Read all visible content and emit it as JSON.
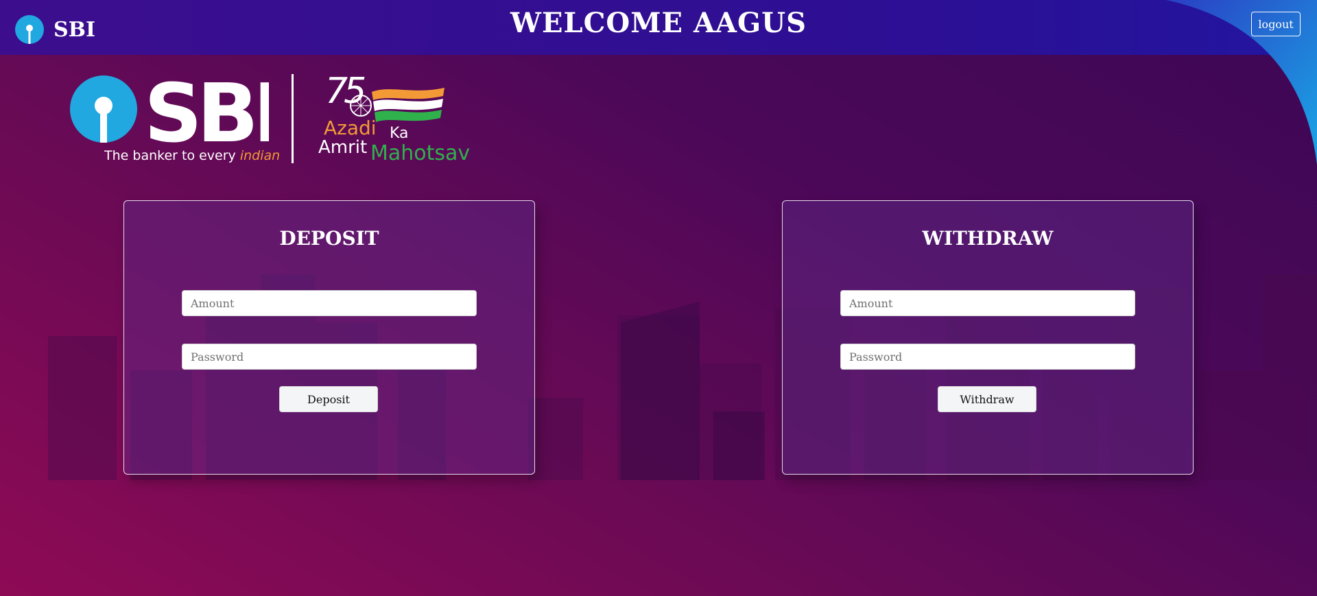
{
  "header": {
    "brand_name": "SBI",
    "welcome_text": "WELCOME AAGUS",
    "logout_label": "logout"
  },
  "logo_banner": {
    "tagline_prefix": "The banker to every",
    "tagline_highlight": "indian",
    "emblem_number": "75",
    "azadi": "Azadi",
    "ka": "Ka",
    "amrit": "Amrit",
    "mahotsav": "Mahotsav"
  },
  "deposit": {
    "title": "DEPOSIT",
    "amount_placeholder": "Amount",
    "password_placeholder": "Password",
    "button_label": "Deposit"
  },
  "withdraw": {
    "title": "WITHDRAW",
    "amount_placeholder": "Amount",
    "password_placeholder": "Password",
    "button_label": "Withdraw"
  },
  "icons": {
    "brand_icon": "sbi-keyhole-icon",
    "emblem_icon": "ashoka-chakra-flag-icon"
  },
  "colors": {
    "accent_cyan": "#21a8e0",
    "orange": "#f39a37",
    "green": "#2fb14c",
    "header_blue": "#2c0f94"
  }
}
